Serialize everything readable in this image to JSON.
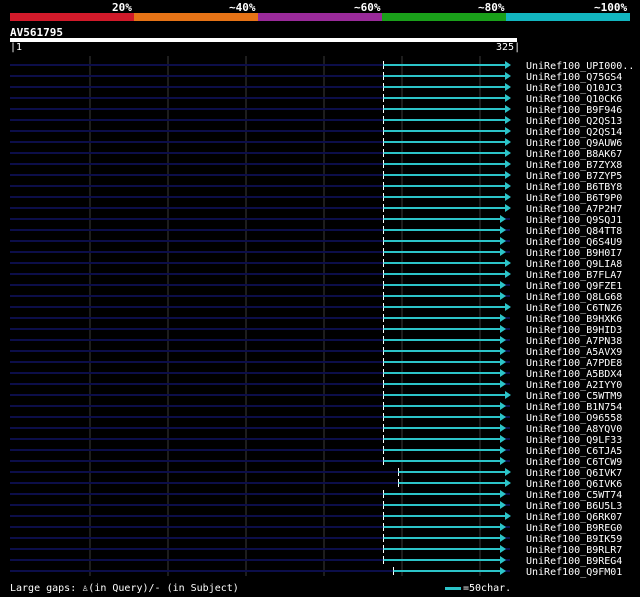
{
  "legend": {
    "labels": [
      "20%",
      "~40%",
      "~60%",
      "~80%",
      "~100%"
    ],
    "colors": [
      "#d11a2a",
      "#e67316",
      "#9a2a9a",
      "#1aa01a",
      "#12b5bf"
    ]
  },
  "query_id": "AV561795",
  "ruler": {
    "start": "1",
    "end": "325"
  },
  "track_color": "#0c0e4a",
  "hit_color": "#2cc4c9",
  "hits": [
    {
      "name": "UniRef100_UPI000..",
      "start": 0.747,
      "end": 1.0
    },
    {
      "name": "UniRef100_Q75GS4",
      "start": 0.747,
      "end": 1.0
    },
    {
      "name": "UniRef100_Q10JC3",
      "start": 0.747,
      "end": 1.0
    },
    {
      "name": "UniRef100_Q10CK6",
      "start": 0.747,
      "end": 1.0
    },
    {
      "name": "UniRef100_B9F946",
      "start": 0.747,
      "end": 1.0
    },
    {
      "name": "UniRef100_Q2QS13",
      "start": 0.747,
      "end": 1.0
    },
    {
      "name": "UniRef100_Q2QS14",
      "start": 0.747,
      "end": 1.0
    },
    {
      "name": "UniRef100_Q9AUW6",
      "start": 0.747,
      "end": 1.0
    },
    {
      "name": "UniRef100_B8AK67",
      "start": 0.747,
      "end": 1.0
    },
    {
      "name": "UniRef100_B7ZYX8",
      "start": 0.747,
      "end": 1.0
    },
    {
      "name": "UniRef100_B7ZYP5",
      "start": 0.747,
      "end": 1.0
    },
    {
      "name": "UniRef100_B6TBY8",
      "start": 0.747,
      "end": 1.0
    },
    {
      "name": "UniRef100_B6T9P0",
      "start": 0.747,
      "end": 1.0
    },
    {
      "name": "UniRef100_A7P2H7",
      "start": 0.747,
      "end": 1.0
    },
    {
      "name": "UniRef100_Q9SQJ1",
      "start": 0.747,
      "end": 0.99
    },
    {
      "name": "UniRef100_Q84TT8",
      "start": 0.747,
      "end": 0.99
    },
    {
      "name": "UniRef100_Q6S4U9",
      "start": 0.747,
      "end": 0.99
    },
    {
      "name": "UniRef100_B9H0I7",
      "start": 0.747,
      "end": 0.99
    },
    {
      "name": "UniRef100_Q9LIA8",
      "start": 0.747,
      "end": 1.0
    },
    {
      "name": "UniRef100_B7FLA7",
      "start": 0.747,
      "end": 1.0
    },
    {
      "name": "UniRef100_Q9FZE1",
      "start": 0.747,
      "end": 0.99
    },
    {
      "name": "UniRef100_Q8LG68",
      "start": 0.747,
      "end": 0.99
    },
    {
      "name": "UniRef100_C6TNZ6",
      "start": 0.747,
      "end": 1.0
    },
    {
      "name": "UniRef100_B9HXK6",
      "start": 0.747,
      "end": 0.99
    },
    {
      "name": "UniRef100_B9HID3",
      "start": 0.747,
      "end": 0.99
    },
    {
      "name": "UniRef100_A7PN38",
      "start": 0.747,
      "end": 0.99
    },
    {
      "name": "UniRef100_A5AVX9",
      "start": 0.747,
      "end": 0.99
    },
    {
      "name": "UniRef100_A7PDE8",
      "start": 0.747,
      "end": 0.99
    },
    {
      "name": "UniRef100_A5BDX4",
      "start": 0.747,
      "end": 0.99
    },
    {
      "name": "UniRef100_A2IYY0",
      "start": 0.747,
      "end": 0.99
    },
    {
      "name": "UniRef100_C5WTM9",
      "start": 0.747,
      "end": 1.0
    },
    {
      "name": "UniRef100_B1N754",
      "start": 0.747,
      "end": 0.99
    },
    {
      "name": "UniRef100_O96558",
      "start": 0.747,
      "end": 0.99
    },
    {
      "name": "UniRef100_A8YQV0",
      "start": 0.747,
      "end": 0.99
    },
    {
      "name": "UniRef100_Q9LF33",
      "start": 0.747,
      "end": 0.99
    },
    {
      "name": "UniRef100_C6TJA5",
      "start": 0.747,
      "end": 0.99
    },
    {
      "name": "UniRef100_C6TCW9",
      "start": 0.747,
      "end": 0.99
    },
    {
      "name": "UniRef100_Q6IVK7",
      "start": 0.777,
      "end": 1.0
    },
    {
      "name": "UniRef100_Q6IVK6",
      "start": 0.777,
      "end": 1.0
    },
    {
      "name": "UniRef100_C5WT74",
      "start": 0.747,
      "end": 0.99
    },
    {
      "name": "UniRef100_B6U5L3",
      "start": 0.747,
      "end": 0.99
    },
    {
      "name": "UniRef100_Q6RK07",
      "start": 0.747,
      "end": 1.0
    },
    {
      "name": "UniRef100_B9REG0",
      "start": 0.747,
      "end": 0.99
    },
    {
      "name": "UniRef100_B9IK59",
      "start": 0.747,
      "end": 0.99
    },
    {
      "name": "UniRef100_B9RLR7",
      "start": 0.747,
      "end": 0.99
    },
    {
      "name": "UniRef100_B9REG4",
      "start": 0.747,
      "end": 0.99
    },
    {
      "name": "UniRef100_Q9FM01",
      "start": 0.767,
      "end": 0.99
    }
  ],
  "footer": {
    "gaps_label": "Large gaps:",
    "query_glyph": "♙",
    "gaps_text": "(in Query)/- (in Subject)",
    "scale_label": "=50char."
  }
}
